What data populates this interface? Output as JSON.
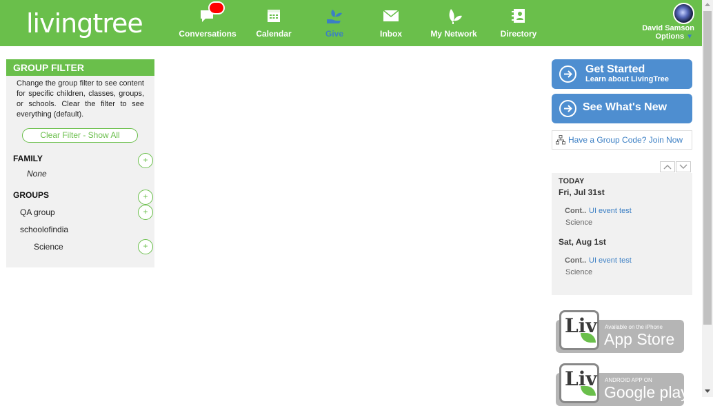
{
  "brand": {
    "logo_text": "livingtree",
    "green": "#6abf4b",
    "blue": "#4e8ed0",
    "link": "#3b7fc4"
  },
  "nav": [
    {
      "label": "Conversations",
      "icon": "chat-bubble-icon",
      "badge": true
    },
    {
      "label": "Calendar",
      "icon": "calendar-icon"
    },
    {
      "label": "Give",
      "icon": "give-hand-plant-icon",
      "active": true
    },
    {
      "label": "Inbox",
      "icon": "envelope-icon"
    },
    {
      "label": "My Network",
      "icon": "leaf-network-icon"
    },
    {
      "label": "Directory",
      "icon": "directory-contact-icon"
    }
  ],
  "user": {
    "name": "David Samson",
    "options_label": "Options"
  },
  "group_filter": {
    "title": "GROUP FILTER",
    "description": "Change the group filter to see content for specific children, classes, groups, or schools. Clear the filter to see everything (default).",
    "clear_button": "Clear Filter - Show All",
    "family_title": "FAMILY",
    "family_none": "None",
    "groups_title": "GROUPS",
    "groups": [
      {
        "label": "QA group"
      },
      {
        "label": "schoolofindia"
      },
      {
        "label": "Science"
      }
    ],
    "plus_symbol": "+"
  },
  "sidebar": {
    "get_started_title": "Get Started",
    "get_started_sub": "Learn about LivingTree",
    "whats_new_title": "See What's New",
    "group_code_link": "Have a Group Code? Join Now"
  },
  "calendar": {
    "today_label": "TODAY",
    "days": [
      {
        "date": "Fri, Jul 31st",
        "event_prefix": "Cont..",
        "event_title": "UI event test",
        "event_group": "Science"
      },
      {
        "date": "Sat, Aug 1st",
        "event_prefix": "Cont..",
        "event_title": "UI event test",
        "event_group": "Science"
      }
    ]
  },
  "stores": [
    {
      "small": "Available on the iPhone",
      "big": "App Store",
      "icon_text": "Liv"
    },
    {
      "small": "ANDROID APP ON",
      "big": "Google play",
      "icon_text": "Liv"
    }
  ]
}
